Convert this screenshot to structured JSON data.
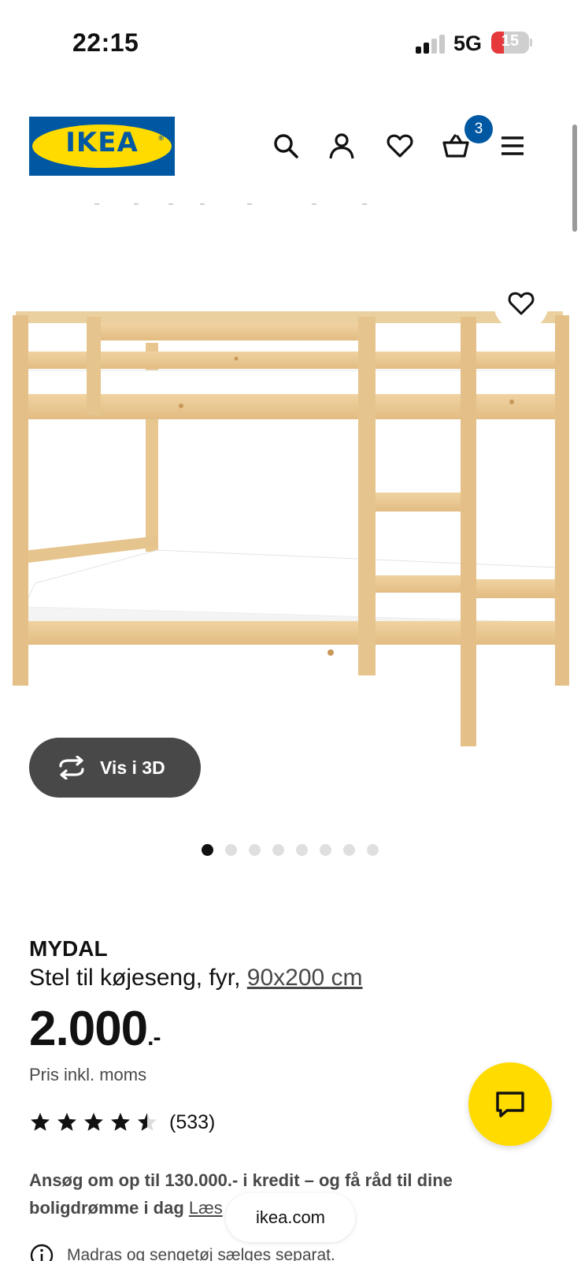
{
  "status_bar": {
    "time": "22:15",
    "network": "5G",
    "battery": "15"
  },
  "header": {
    "logo_text": "IKEA",
    "logo_reg": "®",
    "cart_count": "3",
    "icons": [
      "search-icon",
      "account-icon",
      "favourites-icon",
      "cart-icon",
      "menu-icon"
    ]
  },
  "gallery": {
    "view_3d_label": "Vis i 3D",
    "image_count": 8,
    "active_index": 0
  },
  "product": {
    "name": "MYDAL",
    "description": "Stel til køjeseng, fyr, ",
    "size": "90x200 cm",
    "price": "2.000",
    "price_suffix": ".-",
    "price_note": "Pris inkl. moms",
    "rating": 4.5,
    "rating_count": "(533)"
  },
  "credit": {
    "text": "Ansøg om op til 130.000.- i kredit – og få råd til dine boligdrømme i dag ",
    "link": "Læs"
  },
  "browser": {
    "url": "ikea.com"
  },
  "notice": {
    "text": "Madras og sengetøj sælges separat."
  },
  "colors": {
    "ikea_blue": "#0058a3",
    "ikea_yellow": "#ffdb00",
    "dark_grey": "#484848"
  }
}
